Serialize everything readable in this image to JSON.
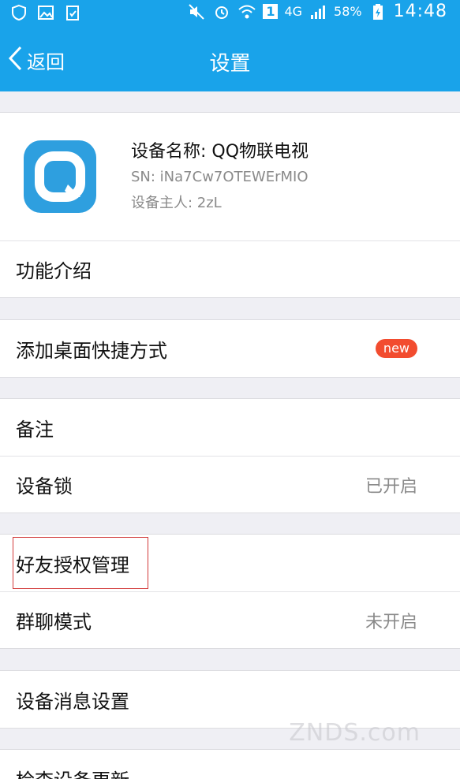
{
  "status_bar": {
    "network_label": "4G",
    "sim_label": "1",
    "battery_text": "58%",
    "time": "14:48"
  },
  "nav": {
    "back_label": "返回",
    "title": "设置"
  },
  "device": {
    "name": "设备名称: QQ物联电视",
    "sn": "SN: iNa7Cw7OTEWErMIO",
    "owner": "设备主人: 2zL"
  },
  "menu": {
    "function_intro": "功能介绍",
    "add_shortcut": "添加桌面快捷方式",
    "new_badge": "new",
    "remark": "备注",
    "device_lock": "设备锁",
    "device_lock_status": "已开启",
    "friend_auth": "好友授权管理",
    "group_chat": "群聊模式",
    "group_chat_status": "未开启",
    "message_settings": "设备消息设置",
    "check_update": "检查设备更新"
  },
  "watermark": "ZNDS.com",
  "colors": {
    "accent": "#19a3ea",
    "badge": "#f24c2f",
    "highlight_border": "#d23a3a"
  }
}
